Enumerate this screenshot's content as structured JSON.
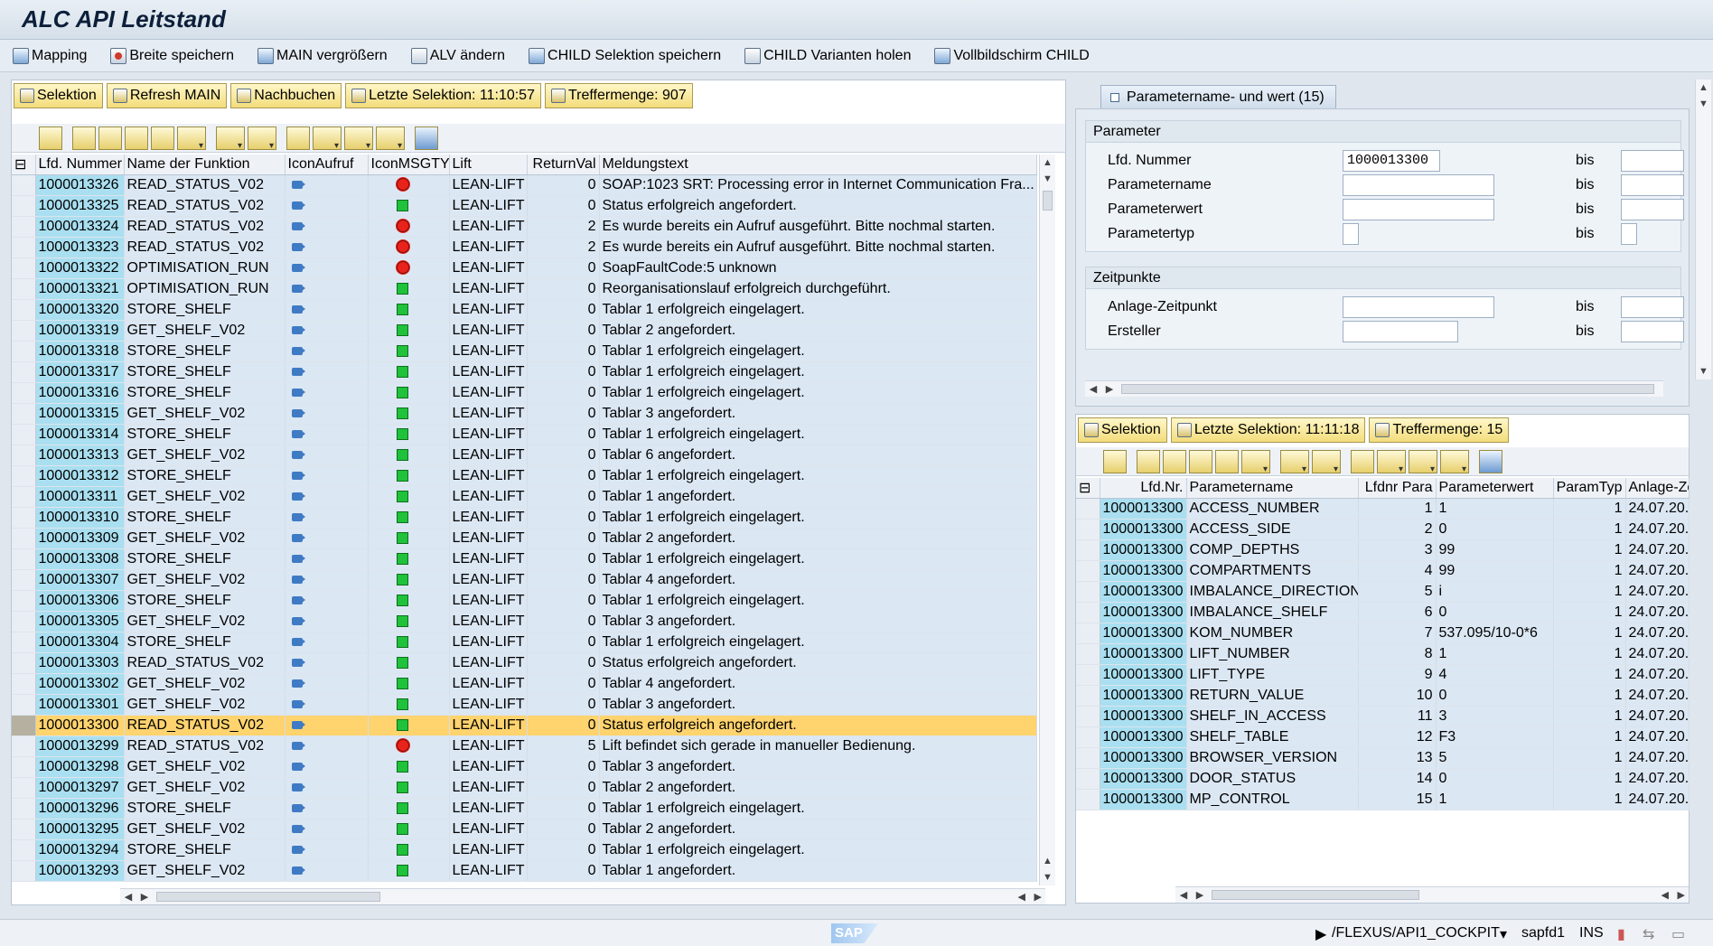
{
  "window": {
    "title": "ALC API Leitstand"
  },
  "appbar": [
    {
      "label": "Mapping",
      "icon": "mapping-icon"
    },
    {
      "label": "Breite speichern",
      "icon": "save-width-icon"
    },
    {
      "label": "MAIN vergrößern",
      "icon": "enlarge-icon"
    },
    {
      "label": "ALV ändern",
      "icon": "alv-change-icon"
    },
    {
      "label": "CHILD Selektion speichern",
      "icon": "save-icon"
    },
    {
      "label": "CHILD Varianten holen",
      "icon": "variants-icon"
    },
    {
      "label": "Vollbildschirm CHILD",
      "icon": "fullscreen-icon"
    }
  ],
  "main": {
    "selbar": {
      "selektion": "Selektion",
      "refresh": "Refresh MAIN",
      "nachbuchen": "Nachbuchen",
      "letzte": "Letzte Selektion: 11:10:57",
      "treffer": "Treffermenge: 907"
    },
    "columns": [
      "Lfd. Nummer",
      "Name der Funktion",
      "IconAufruf",
      "IconMSGTY",
      "Lift",
      "ReturnVal",
      "Meldungstext"
    ],
    "rows": [
      {
        "nr": "1000013326",
        "fn": "READ_STATUS_V02",
        "st": "err",
        "lift": "LEAN-LIFT",
        "rv": "0",
        "msg": "SOAP:1023 SRT: Processing error in Internet Communication Fra..."
      },
      {
        "nr": "1000013325",
        "fn": "READ_STATUS_V02",
        "st": "ok",
        "lift": "LEAN-LIFT",
        "rv": "0",
        "msg": "Status erfolgreich angefordert."
      },
      {
        "nr": "1000013324",
        "fn": "READ_STATUS_V02",
        "st": "err",
        "lift": "LEAN-LIFT",
        "rv": "2",
        "msg": "Es wurde bereits ein Aufruf ausgeführt. Bitte nochmal starten."
      },
      {
        "nr": "1000013323",
        "fn": "READ_STATUS_V02",
        "st": "err",
        "lift": "LEAN-LIFT",
        "rv": "2",
        "msg": "Es wurde bereits ein Aufruf ausgeführt. Bitte nochmal starten."
      },
      {
        "nr": "1000013322",
        "fn": "OPTIMISATION_RUN",
        "st": "err",
        "lift": "LEAN-LIFT",
        "rv": "0",
        "msg": "SoapFaultCode:5  unknown"
      },
      {
        "nr": "1000013321",
        "fn": "OPTIMISATION_RUN",
        "st": "ok",
        "lift": "LEAN-LIFT",
        "rv": "0",
        "msg": "Reorganisationslauf erfolgreich durchgeführt."
      },
      {
        "nr": "1000013320",
        "fn": "STORE_SHELF",
        "st": "ok",
        "lift": "LEAN-LIFT",
        "rv": "0",
        "msg": "Tablar 1 erfolgreich eingelagert."
      },
      {
        "nr": "1000013319",
        "fn": "GET_SHELF_V02",
        "st": "ok",
        "lift": "LEAN-LIFT",
        "rv": "0",
        "msg": "Tablar 2 angefordert."
      },
      {
        "nr": "1000013318",
        "fn": "STORE_SHELF",
        "st": "ok",
        "lift": "LEAN-LIFT",
        "rv": "0",
        "msg": "Tablar 1 erfolgreich eingelagert."
      },
      {
        "nr": "1000013317",
        "fn": "STORE_SHELF",
        "st": "ok",
        "lift": "LEAN-LIFT",
        "rv": "0",
        "msg": "Tablar 1 erfolgreich eingelagert."
      },
      {
        "nr": "1000013316",
        "fn": "STORE_SHELF",
        "st": "ok",
        "lift": "LEAN-LIFT",
        "rv": "0",
        "msg": "Tablar 1 erfolgreich eingelagert."
      },
      {
        "nr": "1000013315",
        "fn": "GET_SHELF_V02",
        "st": "ok",
        "lift": "LEAN-LIFT",
        "rv": "0",
        "msg": "Tablar 3 angefordert."
      },
      {
        "nr": "1000013314",
        "fn": "STORE_SHELF",
        "st": "ok",
        "lift": "LEAN-LIFT",
        "rv": "0",
        "msg": "Tablar 1 erfolgreich eingelagert."
      },
      {
        "nr": "1000013313",
        "fn": "GET_SHELF_V02",
        "st": "ok",
        "lift": "LEAN-LIFT",
        "rv": "0",
        "msg": "Tablar 6 angefordert."
      },
      {
        "nr": "1000013312",
        "fn": "STORE_SHELF",
        "st": "ok",
        "lift": "LEAN-LIFT",
        "rv": "0",
        "msg": "Tablar 1 erfolgreich eingelagert."
      },
      {
        "nr": "1000013311",
        "fn": "GET_SHELF_V02",
        "st": "ok",
        "lift": "LEAN-LIFT",
        "rv": "0",
        "msg": "Tablar 1 angefordert."
      },
      {
        "nr": "1000013310",
        "fn": "STORE_SHELF",
        "st": "ok",
        "lift": "LEAN-LIFT",
        "rv": "0",
        "msg": "Tablar 1 erfolgreich eingelagert."
      },
      {
        "nr": "1000013309",
        "fn": "GET_SHELF_V02",
        "st": "ok",
        "lift": "LEAN-LIFT",
        "rv": "0",
        "msg": "Tablar 2 angefordert."
      },
      {
        "nr": "1000013308",
        "fn": "STORE_SHELF",
        "st": "ok",
        "lift": "LEAN-LIFT",
        "rv": "0",
        "msg": "Tablar 1 erfolgreich eingelagert."
      },
      {
        "nr": "1000013307",
        "fn": "GET_SHELF_V02",
        "st": "ok",
        "lift": "LEAN-LIFT",
        "rv": "0",
        "msg": "Tablar 4 angefordert."
      },
      {
        "nr": "1000013306",
        "fn": "STORE_SHELF",
        "st": "ok",
        "lift": "LEAN-LIFT",
        "rv": "0",
        "msg": "Tablar 1 erfolgreich eingelagert."
      },
      {
        "nr": "1000013305",
        "fn": "GET_SHELF_V02",
        "st": "ok",
        "lift": "LEAN-LIFT",
        "rv": "0",
        "msg": "Tablar 3 angefordert."
      },
      {
        "nr": "1000013304",
        "fn": "STORE_SHELF",
        "st": "ok",
        "lift": "LEAN-LIFT",
        "rv": "0",
        "msg": "Tablar 1 erfolgreich eingelagert."
      },
      {
        "nr": "1000013303",
        "fn": "READ_STATUS_V02",
        "st": "ok",
        "lift": "LEAN-LIFT",
        "rv": "0",
        "msg": "Status erfolgreich angefordert."
      },
      {
        "nr": "1000013302",
        "fn": "GET_SHELF_V02",
        "st": "ok",
        "lift": "LEAN-LIFT",
        "rv": "0",
        "msg": "Tablar 4 angefordert."
      },
      {
        "nr": "1000013301",
        "fn": "GET_SHELF_V02",
        "st": "ok",
        "lift": "LEAN-LIFT",
        "rv": "0",
        "msg": "Tablar 3 angefordert."
      },
      {
        "nr": "1000013300",
        "fn": "READ_STATUS_V02",
        "st": "ok",
        "lift": "LEAN-LIFT",
        "rv": "0",
        "msg": "Status erfolgreich angefordert.",
        "selected": true
      },
      {
        "nr": "1000013299",
        "fn": "READ_STATUS_V02",
        "st": "err",
        "lift": "LEAN-LIFT",
        "rv": "5",
        "msg": "Lift befindet sich gerade in manueller Bedienung."
      },
      {
        "nr": "1000013298",
        "fn": "GET_SHELF_V02",
        "st": "ok",
        "lift": "LEAN-LIFT",
        "rv": "0",
        "msg": "Tablar 3 angefordert."
      },
      {
        "nr": "1000013297",
        "fn": "GET_SHELF_V02",
        "st": "ok",
        "lift": "LEAN-LIFT",
        "rv": "0",
        "msg": "Tablar 2 angefordert."
      },
      {
        "nr": "1000013296",
        "fn": "STORE_SHELF",
        "st": "ok",
        "lift": "LEAN-LIFT",
        "rv": "0",
        "msg": "Tablar 1 erfolgreich eingelagert."
      },
      {
        "nr": "1000013295",
        "fn": "GET_SHELF_V02",
        "st": "ok",
        "lift": "LEAN-LIFT",
        "rv": "0",
        "msg": "Tablar 2 angefordert."
      },
      {
        "nr": "1000013294",
        "fn": "STORE_SHELF",
        "st": "ok",
        "lift": "LEAN-LIFT",
        "rv": "0",
        "msg": "Tablar 1 erfolgreich eingelagert."
      },
      {
        "nr": "1000013293",
        "fn": "GET_SHELF_V02",
        "st": "ok",
        "lift": "LEAN-LIFT",
        "rv": "0",
        "msg": "Tablar 1 angefordert."
      }
    ]
  },
  "param_tab": {
    "label": "Parametername- und wert (15)"
  },
  "form": {
    "group1": "Parameter",
    "lfd_nummer": {
      "label": "Lfd. Nummer",
      "value": "1000013300"
    },
    "parametername": {
      "label": "Parametername",
      "value": ""
    },
    "parameterwert": {
      "label": "Parameterwert",
      "value": ""
    },
    "parametertyp": {
      "label": "Parametertyp",
      "value": ""
    },
    "group2": "Zeitpunkte",
    "anlage": {
      "label": "Anlage-Zeitpunkt",
      "value": ""
    },
    "ersteller": {
      "label": "Ersteller",
      "value": ""
    },
    "bis": "bis"
  },
  "child": {
    "selbar": {
      "selektion": "Selektion",
      "letzte": "Letzte Selektion: 11:11:18",
      "treffer": "Treffermenge: 15"
    },
    "columns": [
      "Lfd.Nr.",
      "Parametername",
      "Lfdnr Para",
      "Parameterwert",
      "ParamTyp",
      "Anlage-Ze..."
    ],
    "rows": [
      {
        "nr": "1000013300",
        "name": "ACCESS_NUMBER",
        "lp": "1",
        "val": "1",
        "typ": "1",
        "date": "24.07.20..."
      },
      {
        "nr": "1000013300",
        "name": "ACCESS_SIDE",
        "lp": "2",
        "val": "0",
        "typ": "1",
        "date": "24.07.20..."
      },
      {
        "nr": "1000013300",
        "name": "COMP_DEPTHS",
        "lp": "3",
        "val": "99",
        "typ": "1",
        "date": "24.07.20..."
      },
      {
        "nr": "1000013300",
        "name": "COMPARTMENTS",
        "lp": "4",
        "val": "99",
        "typ": "1",
        "date": "24.07.20..."
      },
      {
        "nr": "1000013300",
        "name": "IMBALANCE_DIRECTION",
        "lp": "5",
        "val": "i",
        "typ": "1",
        "date": "24.07.20..."
      },
      {
        "nr": "1000013300",
        "name": "IMBALANCE_SHELF",
        "lp": "6",
        "val": "0",
        "typ": "1",
        "date": "24.07.20..."
      },
      {
        "nr": "1000013300",
        "name": "KOM_NUMBER",
        "lp": "7",
        "val": "537.095/10-0*6",
        "typ": "1",
        "date": "24.07.20..."
      },
      {
        "nr": "1000013300",
        "name": "LIFT_NUMBER",
        "lp": "8",
        "val": "1",
        "typ": "1",
        "date": "24.07.20..."
      },
      {
        "nr": "1000013300",
        "name": "LIFT_TYPE",
        "lp": "9",
        "val": "4",
        "typ": "1",
        "date": "24.07.20..."
      },
      {
        "nr": "1000013300",
        "name": "RETURN_VALUE",
        "lp": "10",
        "val": "0",
        "typ": "1",
        "date": "24.07.20..."
      },
      {
        "nr": "1000013300",
        "name": "SHELF_IN_ACCESS",
        "lp": "11",
        "val": "3",
        "typ": "1",
        "date": "24.07.20..."
      },
      {
        "nr": "1000013300",
        "name": "SHELF_TABLE",
        "lp": "12",
        "val": "F3",
        "typ": "1",
        "date": "24.07.20..."
      },
      {
        "nr": "1000013300",
        "name": "BROWSER_VERSION",
        "lp": "13",
        "val": "5",
        "typ": "1",
        "date": "24.07.20..."
      },
      {
        "nr": "1000013300",
        "name": "DOOR_STATUS",
        "lp": "14",
        "val": "0",
        "typ": "1",
        "date": "24.07.20..."
      },
      {
        "nr": "1000013300",
        "name": "MP_CONTROL",
        "lp": "15",
        "val": "1",
        "typ": "1",
        "date": "24.07.20..."
      }
    ]
  },
  "statusbar": {
    "sap": "SAP",
    "transaction": "/FLEXUS/API1_COCKPIT",
    "system": "sapfd1",
    "mode": "INS"
  }
}
